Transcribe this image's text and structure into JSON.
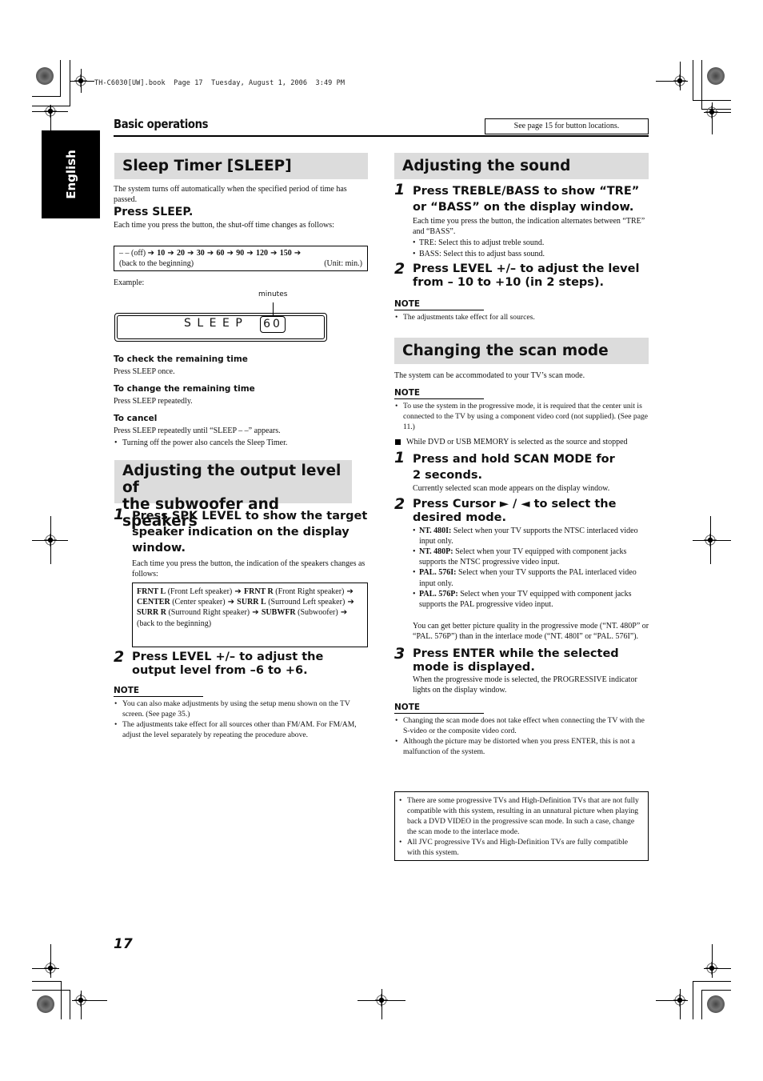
{
  "print_header": {
    "file_info": "TH-C6030[UW].book  Page 17  Tuesday, August 1, 2006  3:49 PM"
  },
  "language_tab": "English",
  "header": {
    "section": "Basic operations",
    "see_note": "See page 15 for button locations."
  },
  "sleep_timer": {
    "title": "Sleep Timer [SLEEP]",
    "intro": "The system turns off automatically when the specified period of time has passed.",
    "press": "Press SLEEP.",
    "press_desc": "Each time you press the button, the shut-off time changes as follows:",
    "sequence": {
      "start": "– – (off)",
      "values": [
        "10",
        "20",
        "30",
        "60",
        "90",
        "120",
        "150"
      ],
      "end": "(back to the beginning)",
      "unit": "(Unit: min.)"
    },
    "example_label": "Example:",
    "display": {
      "text": "SLEEP",
      "value": "60",
      "annotation": "minutes"
    },
    "check": {
      "heading": "To check the remaining time",
      "text": "Press SLEEP once."
    },
    "change": {
      "heading": "To change the remaining time",
      "text": "Press SLEEP repeatedly."
    },
    "cancel": {
      "heading": "To cancel",
      "text": "Press SLEEP repeatedly until “SLEEP – –” appears.",
      "bullet": "Turning off the power also cancels the Sleep Timer."
    }
  },
  "output_level": {
    "title_line1": "Adjusting the output level of",
    "title_line2": "the subwoofer and speakers",
    "step1": {
      "num": "1",
      "text": "Press SPK LEVEL to show the target speaker indication on the display window.",
      "desc": "Each time you press the button, the indication of the speakers changes as follows:"
    },
    "speakers": [
      {
        "code": "FRNT L",
        "desc": "(Front Left speaker)"
      },
      {
        "code": "FRNT R",
        "desc": "(Front Right speaker)"
      },
      {
        "code": "CENTER",
        "desc": "(Center speaker)"
      },
      {
        "code": "SURR L",
        "desc": "(Surround Left speaker)"
      },
      {
        "code": "SURR R",
        "desc": "(Surround Right speaker)"
      },
      {
        "code": "SUBWFR",
        "desc": "(Subwoofer)"
      }
    ],
    "speakers_end": "(back to the beginning)",
    "step2": {
      "num": "2",
      "text": "Press LEVEL +/– to adjust the output level from –6 to +6."
    },
    "note_label": "NOTE",
    "notes": [
      "You can also make adjustments by using the setup menu shown on the TV screen. (See page 35.)",
      "The adjustments take effect for all sources other than FM/AM. For FM/AM, adjust the level separately by repeating the procedure above."
    ]
  },
  "sound": {
    "title": "Adjusting the sound",
    "step1": {
      "num": "1",
      "text": "Press TREBLE/BASS to show “TRE” or “BASS” on the display window.",
      "desc": "Each time you press the button, the indication alternates between “TRE” and “BASS”.",
      "bullets": [
        "TRE: Select this to adjust treble sound.",
        "BASS: Select this to adjust bass sound."
      ]
    },
    "step2": {
      "num": "2",
      "text": "Press LEVEL +/– to adjust the level from – 10 to +10 (in 2 steps)."
    },
    "note_label": "NOTE",
    "notes": [
      "The adjustments take effect for all sources."
    ]
  },
  "scan_mode": {
    "title": "Changing the scan mode",
    "intro": "The system can be accommodated to your TV’s scan mode.",
    "note_label": "NOTE",
    "note1": "To use the system in the progressive mode, it is required that the center unit is connected to the TV by using a component video cord (not supplied). (See page 11.)",
    "condition": "While DVD or USB MEMORY is selected as the source and stopped",
    "step1": {
      "num": "1",
      "text_a": "Press and hold SCAN MODE for",
      "text_b": "2 seconds.",
      "desc": "Currently selected scan mode appears on the display window."
    },
    "step2": {
      "num": "2",
      "text": "Press Cursor ► / ◄ to select the desired mode.",
      "modes": [
        {
          "code": "NT. 480I:",
          "desc": "Select when your TV supports the NTSC interlaced video input only."
        },
        {
          "code": "NT. 480P:",
          "desc": "Select when your TV equipped with component jacks supports the NTSC progressive video input."
        },
        {
          "code": "PAL. 576I:",
          "desc": "Select when your TV supports the PAL interlaced video input only."
        },
        {
          "code": "PAL. 576P:",
          "desc": "Select when your TV equipped with component jacks supports the PAL progressive video input."
        }
      ],
      "quality": "You can get better picture quality in the progressive mode (“NT. 480P” or “PAL. 576P”) than in the interlace mode (“NT. 480I” or “PAL. 576I”)."
    },
    "step3": {
      "num": "3",
      "text": "Press ENTER while the selected mode is displayed.",
      "desc": "When the progressive mode is selected, the PROGRESSIVE indicator lights on the display window."
    },
    "note2_label": "NOTE",
    "notes2": [
      "Changing the scan mode does not take effect when connecting the TV with the S-video or the composite video cord.",
      "Although the picture may be distorted when you press ENTER, this is not a malfunction of the system."
    ],
    "caution": [
      "There are some progressive TVs and High-Definition TVs that are not fully compatible with this system, resulting in an unnatural picture when playing back a DVD VIDEO in the progressive scan mode. In such a case, change the scan mode to the interlace mode.",
      "All JVC progressive TVs and High-Definition TVs are fully compatible with this system."
    ]
  },
  "footer": {
    "page_number": "17"
  }
}
